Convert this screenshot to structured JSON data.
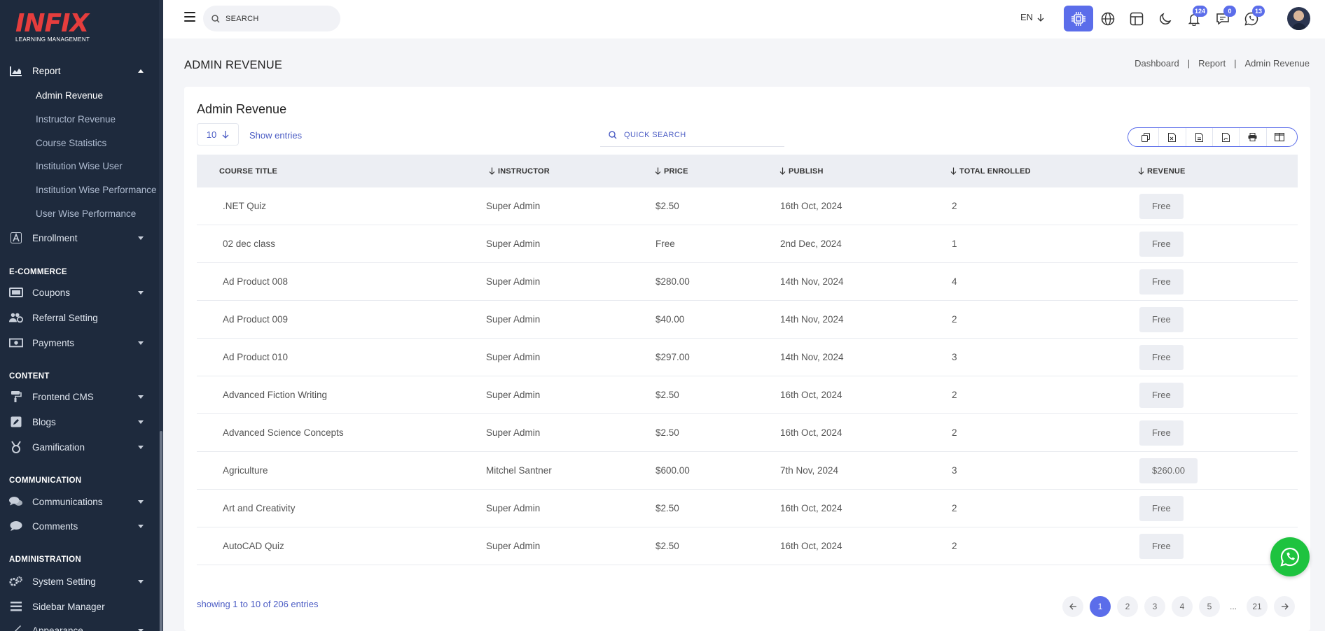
{
  "logo": {
    "main": "INFIX",
    "sub": "LEARNING MANAGEMENT"
  },
  "sidebar": {
    "report": {
      "label": "Report",
      "icon": "chart-area-icon"
    },
    "report_sub": [
      {
        "label": "Admin Revenue",
        "active": true
      },
      {
        "label": "Instructor Revenue"
      },
      {
        "label": "Course Statistics"
      },
      {
        "label": "Institution Wise User"
      },
      {
        "label": "Institution Wise Performance"
      },
      {
        "label": "User Wise Performance"
      }
    ],
    "enrollment": {
      "label": "Enrollment",
      "icon": "font-a-icon"
    },
    "sections": {
      "ecommerce": "E-COMMERCE",
      "content": "CONTENT",
      "communication": "COMMUNICATION",
      "administration": "ADMINISTRATION"
    },
    "coupons": {
      "label": "Coupons",
      "icon": "ticket-icon"
    },
    "referral": {
      "label": "Referral Setting",
      "icon": "users-cog-icon"
    },
    "payments": {
      "label": "Payments",
      "icon": "money-bill-icon"
    },
    "frontend_cms": {
      "label": "Frontend CMS",
      "icon": "paint-roller-icon"
    },
    "blogs": {
      "label": "Blogs",
      "icon": "edit-icon"
    },
    "gamification": {
      "label": "Gamification",
      "icon": "medal-icon"
    },
    "communications": {
      "label": "Communications",
      "icon": "comments-icon"
    },
    "comments": {
      "label": "Comments",
      "icon": "comment-icon"
    },
    "system_setting": {
      "label": "System Setting",
      "icon": "cogs-icon"
    },
    "sidebar_manager": {
      "label": "Sidebar Manager",
      "icon": "bars-icon"
    },
    "appearance": {
      "label": "Appearance",
      "icon": "brush-icon"
    }
  },
  "header": {
    "search_placeholder": "SEARCH",
    "language": "EN",
    "notifications_count": "124",
    "messages_count": "0",
    "whatsapp_count": "13"
  },
  "page": {
    "title": "ADMIN REVENUE",
    "breadcrumb": [
      "Dashboard",
      "Report",
      "Admin Revenue"
    ]
  },
  "card": {
    "title": "Admin Revenue",
    "entries_value": "10",
    "show_entries": "Show entries",
    "quick_search_placeholder": "QUICK SEARCH"
  },
  "table": {
    "columns": [
      "COURSE TITLE",
      "INSTRUCTOR",
      "PRICE",
      "PUBLISH",
      "TOTAL ENROLLED",
      "REVENUE"
    ],
    "rows": [
      {
        "title": ".NET Quiz",
        "instructor": "Super Admin",
        "price": "$2.50",
        "publish": "16th Oct, 2024",
        "enrolled": "2",
        "revenue": "Free"
      },
      {
        "title": "02 dec class",
        "instructor": "Super Admin",
        "price": "Free",
        "publish": "2nd Dec, 2024",
        "enrolled": "1",
        "revenue": "Free"
      },
      {
        "title": "Ad Product 008",
        "instructor": "Super Admin",
        "price": "$280.00",
        "publish": "14th Nov, 2024",
        "enrolled": "4",
        "revenue": "Free"
      },
      {
        "title": "Ad Product 009",
        "instructor": "Super Admin",
        "price": "$40.00",
        "publish": "14th Nov, 2024",
        "enrolled": "2",
        "revenue": "Free"
      },
      {
        "title": "Ad Product 010",
        "instructor": "Super Admin",
        "price": "$297.00",
        "publish": "14th Nov, 2024",
        "enrolled": "3",
        "revenue": "Free"
      },
      {
        "title": "Advanced Fiction Writing",
        "instructor": "Super Admin",
        "price": "$2.50",
        "publish": "16th Oct, 2024",
        "enrolled": "2",
        "revenue": "Free"
      },
      {
        "title": "Advanced Science Concepts",
        "instructor": "Super Admin",
        "price": "$2.50",
        "publish": "16th Oct, 2024",
        "enrolled": "2",
        "revenue": "Free"
      },
      {
        "title": "Agriculture",
        "instructor": "Mitchel Santner",
        "price": "$600.00",
        "publish": "7th Nov, 2024",
        "enrolled": "3",
        "revenue": "$260.00"
      },
      {
        "title": "Art and Creativity",
        "instructor": "Super Admin",
        "price": "$2.50",
        "publish": "16th Oct, 2024",
        "enrolled": "2",
        "revenue": "Free"
      },
      {
        "title": "AutoCAD Quiz",
        "instructor": "Super Admin",
        "price": "$2.50",
        "publish": "16th Oct, 2024",
        "enrolled": "2",
        "revenue": "Free"
      }
    ]
  },
  "footer": {
    "showing": "showing 1 to 10 of 206 entries",
    "pages": [
      "1",
      "2",
      "3",
      "4",
      "5",
      "...",
      "21"
    ],
    "current_page": "1"
  },
  "colors": {
    "sidebar_bg": "#1e2a3d",
    "accent": "#5b6dea",
    "logo": "#e53d3d",
    "whatsapp": "#1ec33f"
  }
}
